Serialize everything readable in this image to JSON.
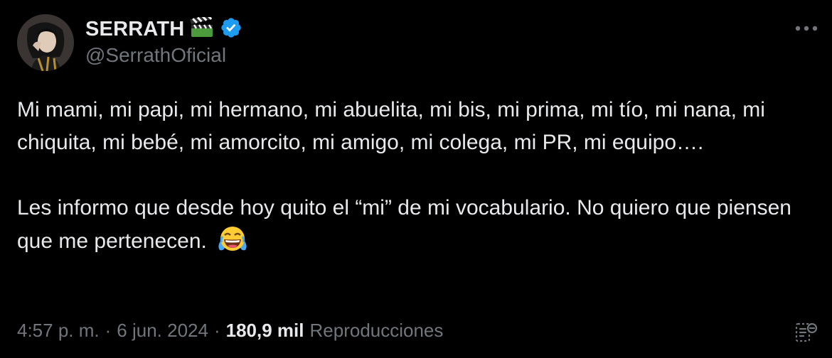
{
  "author": {
    "display_name": "SERRATH",
    "handle": "@SerrathOficial",
    "verified": true,
    "badge_emoji_icon": "clapper-board-icon",
    "verified_color": "#1d9bf0"
  },
  "tweet": {
    "paragraph_1": "Mi mami, mi papi, mi hermano, mi abuelita, mi bis, mi prima, mi tío, mi nana, mi chiquita, mi bebé, mi amorcito, mi amigo, mi colega, mi PR, mi equipo….",
    "paragraph_2": "Les informo que desde hoy quito el “mi” de mi vocabulario. No quiero que piensen que me pertenecen.",
    "trailing_emoji_icon": "face-with-tears-of-joy-icon"
  },
  "meta": {
    "time": "4:57 p. m.",
    "separator": "·",
    "date": "6 jun. 2024",
    "views_count": "180,9 mil",
    "views_label": "Reproducciones"
  },
  "colors": {
    "background": "#000000",
    "primary_text": "#e7e9ea",
    "secondary_text": "#71767b"
  }
}
